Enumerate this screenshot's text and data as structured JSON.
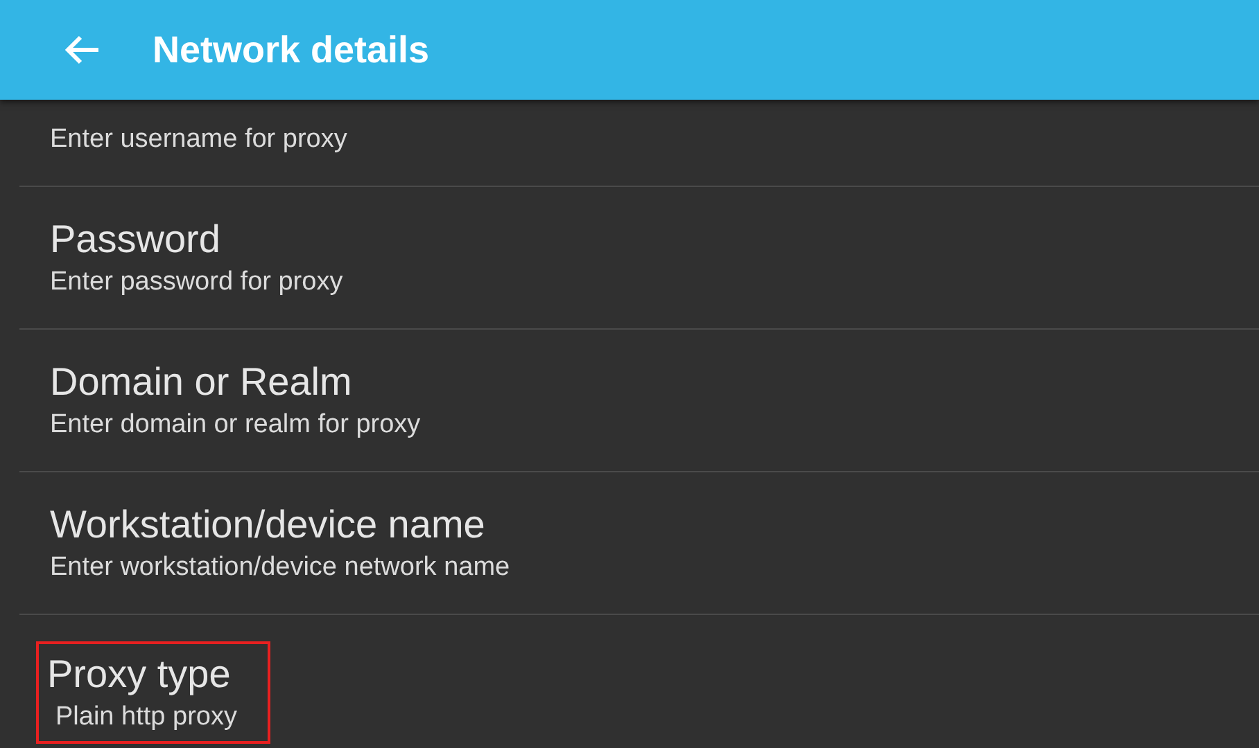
{
  "app_bar": {
    "title": "Network details"
  },
  "settings": [
    {
      "subtitle": "Enter username for proxy",
      "highlighted": false
    },
    {
      "title": "Password",
      "subtitle": "Enter password for proxy",
      "highlighted": false
    },
    {
      "title": "Domain or Realm",
      "subtitle": "Enter domain or realm for proxy",
      "highlighted": false
    },
    {
      "title": "Workstation/device name",
      "subtitle": "Enter workstation/device network name",
      "highlighted": false
    },
    {
      "title": "Proxy type",
      "subtitle": "Plain http proxy",
      "highlighted": true
    }
  ]
}
